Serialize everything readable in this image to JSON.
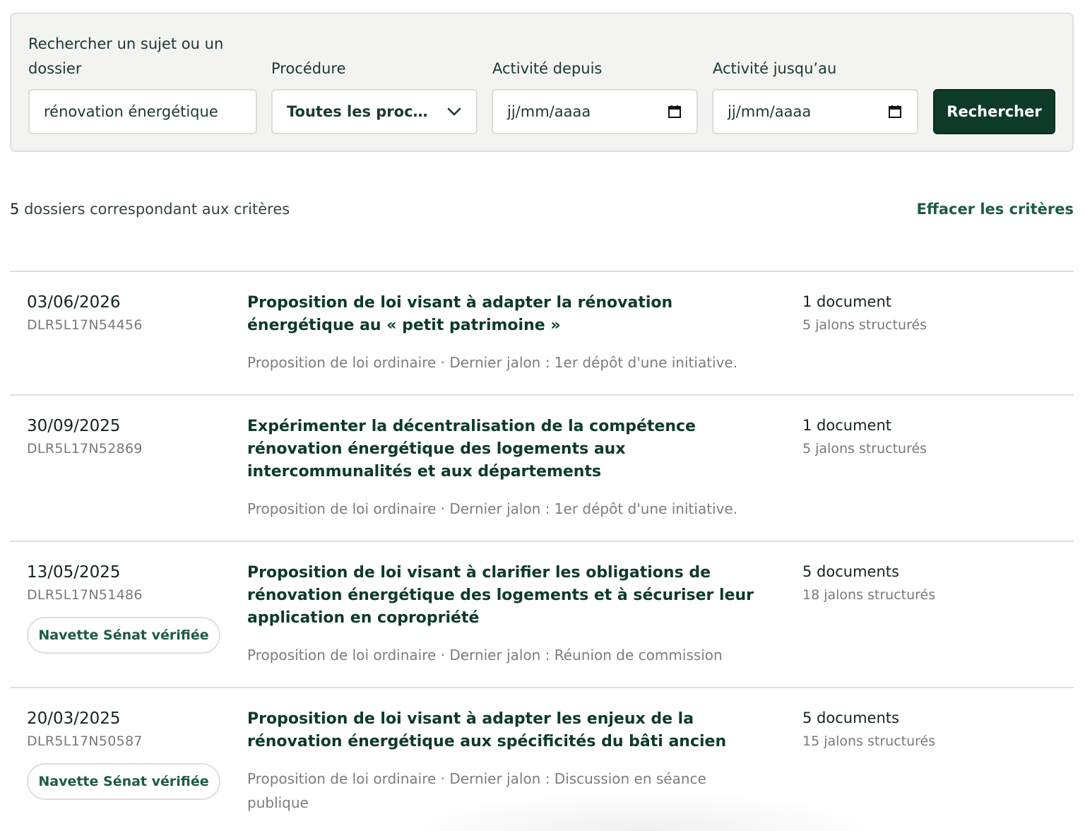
{
  "search": {
    "subject_label": "Rechercher un sujet ou un dossier",
    "subject_value": "rénovation énergétique",
    "procedure_label": "Procédure",
    "procedure_value": "Toutes les proc…",
    "from_label": "Activité depuis",
    "from_placeholder": "jj/mm/aaaa",
    "to_label": "Activité jusqu’au",
    "to_placeholder": "jj/mm/aaaa",
    "submit_label": "Rechercher"
  },
  "summary": {
    "count": "5",
    "count_text": "dossiers correspondant aux critères",
    "clear_label": "Effacer les critères"
  },
  "results": [
    {
      "date": "03/06/2026",
      "ref": "DLR5L17N54456",
      "badge": "",
      "title": "Proposition de loi visant à adapter la rénovation énergétique au « petit patrimoine »",
      "meta": "Proposition de loi ordinaire · Dernier jalon : 1er dépôt d'une initiative.",
      "documents": "1 document",
      "milestones": "5 jalons structurés"
    },
    {
      "date": "30/09/2025",
      "ref": "DLR5L17N52869",
      "badge": "",
      "title": "Expérimenter la décentralisation de la compétence rénovation énergétique des logements aux intercommunalités et aux départements",
      "meta": "Proposition de loi ordinaire · Dernier jalon : 1er dépôt d'une initiative.",
      "documents": "1 document",
      "milestones": "5 jalons structurés"
    },
    {
      "date": "13/05/2025",
      "ref": "DLR5L17N51486",
      "badge": "Navette Sénat vérifiée",
      "title": "Proposition de loi visant à clarifier les obligations de rénovation énergétique des logements et à sécuriser leur application en copropriété",
      "meta": "Proposition de loi ordinaire · Dernier jalon : Réunion de commission",
      "documents": "5 documents",
      "milestones": "18 jalons structurés"
    },
    {
      "date": "20/03/2025",
      "ref": "DLR5L17N50587",
      "badge": "Navette Sénat vérifiée",
      "title": "Proposition de loi visant à adapter les enjeux de la rénovation énergétique aux spécificités du bâti ancien",
      "meta": "Proposition de loi ordinaire · Dernier jalon : Discussion en séance publique",
      "documents": "5 documents",
      "milestones": "15 jalons structurés"
    }
  ],
  "icons": {
    "procedure_dropdown": "chevron-down-icon",
    "date_picker": "calendar-icon"
  },
  "colors": {
    "brand": "#0e3a2a",
    "accent": "#1d5b45",
    "panel": "#f3f3f2"
  }
}
